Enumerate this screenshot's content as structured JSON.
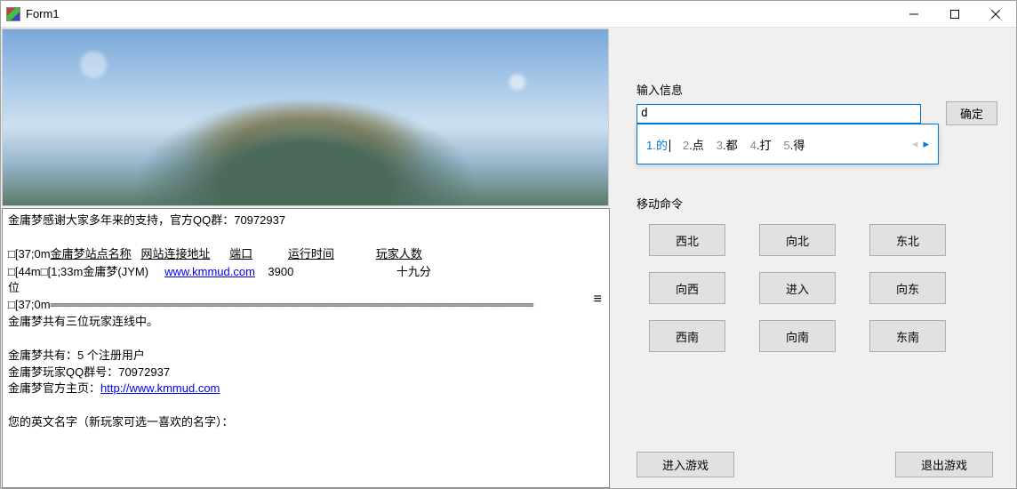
{
  "window": {
    "title": "Form1"
  },
  "console": {
    "line1": "金庸梦感谢大家多年来的支持，官方QQ群：70972937",
    "headers_prefix": "□[37;0m",
    "headers": {
      "c1": "金庸梦站点名称",
      "c2": "网站连接地址",
      "c3": "端口",
      "c4": "运行时间",
      "c5": "玩家人数"
    },
    "row_prefix": "□[44m□[1;33m",
    "row_site": "金庸梦(JYM)",
    "row_url": "www.kmmud.com",
    "row_port": "3900",
    "row_players": "十九分",
    "row_tail": "位",
    "sep_prefix": "□[37;0m",
    "sep": "═══════════════════════════════════════════════════════════",
    "online": "金庸梦共有三位玩家连线中。",
    "reg": "金庸梦共有：5 个注册用户",
    "qq": "金庸梦玩家QQ群号：70972937",
    "homepage_label": "金庸梦官方主页：",
    "homepage_url": "http://www.kmmud.com",
    "prompt": "您的英文名字（新玩家可选一喜欢的名字）："
  },
  "input": {
    "group_label": "输入信息",
    "value": "d",
    "confirm": "确定"
  },
  "ime": {
    "candidates": [
      {
        "n": "1",
        "ch": "的"
      },
      {
        "n": "2",
        "ch": "点"
      },
      {
        "n": "3",
        "ch": "都"
      },
      {
        "n": "4",
        "ch": "打"
      },
      {
        "n": "5",
        "ch": "得"
      }
    ]
  },
  "move": {
    "group_label": "移动命令",
    "nw": "西北",
    "n": "向北",
    "ne": "东北",
    "w": "向西",
    "c": "进入",
    "e": "向东",
    "sw": "西南",
    "s": "向南",
    "se": "东南"
  },
  "bottom": {
    "enter": "进入游戏",
    "exit": "退出游戏"
  }
}
